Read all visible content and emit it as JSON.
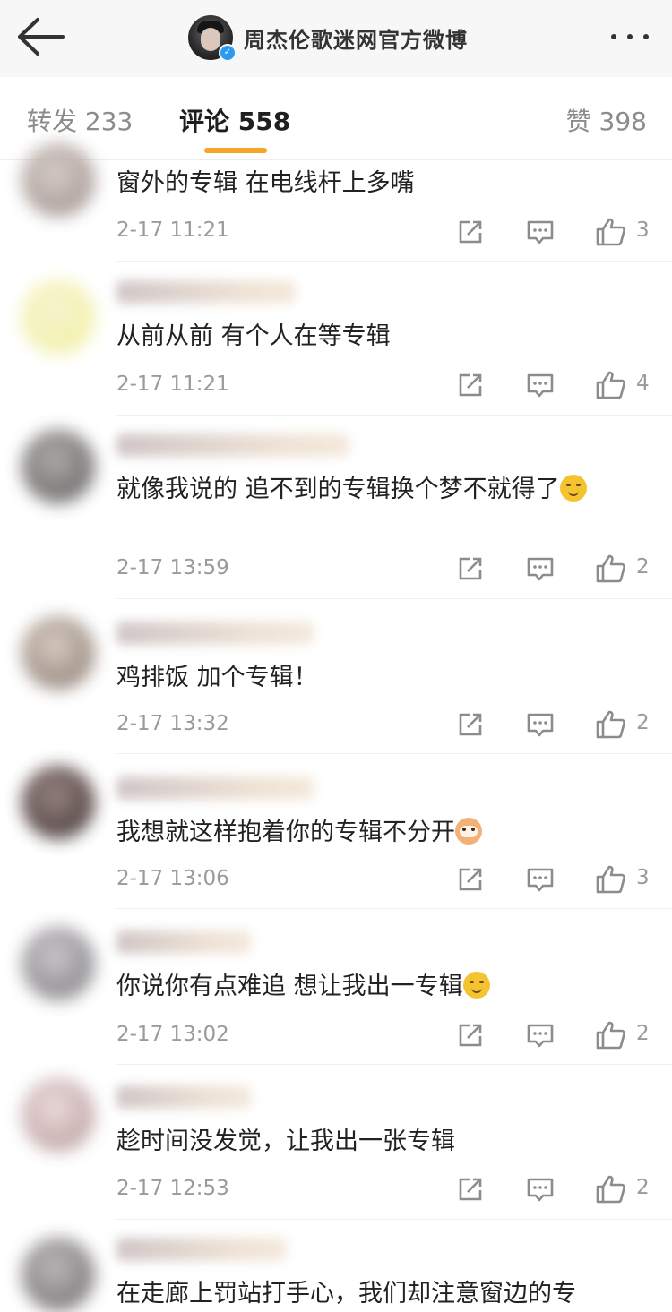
{
  "nav": {
    "title": "周杰伦歌迷网官方微博"
  },
  "tabs": {
    "repost": "转发 233",
    "comment": "评论 558",
    "like": "赞 398"
  },
  "colors": {
    "accent": "#f5a623",
    "verified": "#2a9bf0"
  },
  "comments": [
    {
      "text": "窗外的专辑 在电线杆上多嘴",
      "time": "2-17 11:21",
      "likes": "3",
      "emoji": ""
    },
    {
      "text": "从前从前 有个人在等专辑",
      "time": "2-17 11:21",
      "likes": "4",
      "emoji": ""
    },
    {
      "text": "就像我说的 追不到的专辑换个梦不就得了",
      "time": "2-17 13:59",
      "likes": "2",
      "emoji": "doge"
    },
    {
      "text": "鸡排饭 加个专辑！",
      "time": "2-17 13:32",
      "likes": "2",
      "emoji": ""
    },
    {
      "text": "我想就这样抱着你的专辑不分开",
      "time": "2-17 13:06",
      "likes": "3",
      "emoji": "cat"
    },
    {
      "text": "你说你有点难追 想让我出一专辑",
      "time": "2-17 13:02",
      "likes": "2",
      "emoji": "doge"
    },
    {
      "text": "趁时间没发觉，让我出一张专辑",
      "time": "2-17 12:53",
      "likes": "2",
      "emoji": ""
    },
    {
      "text": "在走廊上罚站打手心，我们却注意窗边的专",
      "time": "",
      "likes": "",
      "emoji": ""
    }
  ]
}
